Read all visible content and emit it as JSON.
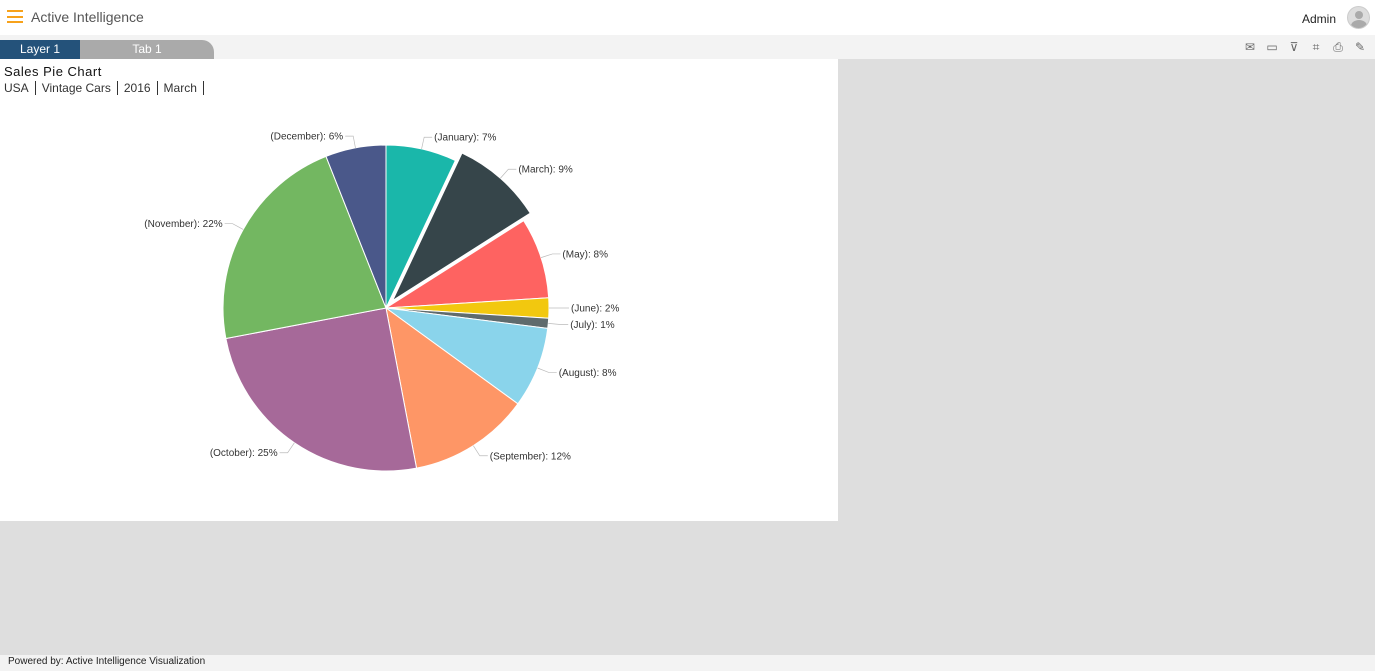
{
  "header": {
    "brand": "Active Intelligence",
    "user": "Admin"
  },
  "tabs": [
    {
      "label": "Layer 1"
    },
    {
      "label": "Tab 1"
    }
  ],
  "toolbar_icons": [
    "mail-icon",
    "comment-icon",
    "clear-filter-icon",
    "crop-icon",
    "print-icon",
    "edit-icon"
  ],
  "panel": {
    "title": "Sales Pie Chart",
    "breadcrumbs": [
      "USA",
      "Vintage Cars",
      "2016",
      "March"
    ]
  },
  "footer": {
    "text": "Powered by: Active Intelligence Visualization"
  },
  "chart_data": {
    "type": "pie",
    "title": "Sales Pie Chart",
    "start": "top-clockwise",
    "exploded": "(March)",
    "slices": [
      {
        "label": "(January)",
        "value": 7,
        "text": "(January): 7%",
        "color": "#1ab7aa"
      },
      {
        "label": "(March)",
        "value": 9,
        "text": "(March): 9%",
        "color": "#36454a"
      },
      {
        "label": "(May)",
        "value": 8,
        "text": "(May): 8%",
        "color": "#fe6361"
      },
      {
        "label": "(June)",
        "value": 2,
        "text": "(June): 2%",
        "color": "#f2c80f"
      },
      {
        "label": "(July)",
        "value": 1,
        "text": "(July): 1%",
        "color": "#5f6b6d"
      },
      {
        "label": "(August)",
        "value": 8,
        "text": "(August): 8%",
        "color": "#8ad4eb"
      },
      {
        "label": "(September)",
        "value": 12,
        "text": "(September): 12%",
        "color": "#fe9666"
      },
      {
        "label": "(October)",
        "value": 25,
        "text": "(October): 25%",
        "color": "#a66999"
      },
      {
        "label": "(November)",
        "value": 22,
        "text": "(November): 22%",
        "color": "#73b761"
      },
      {
        "label": "(December)",
        "value": 6,
        "text": "(December): 6%",
        "color": "#4a588a"
      }
    ]
  }
}
